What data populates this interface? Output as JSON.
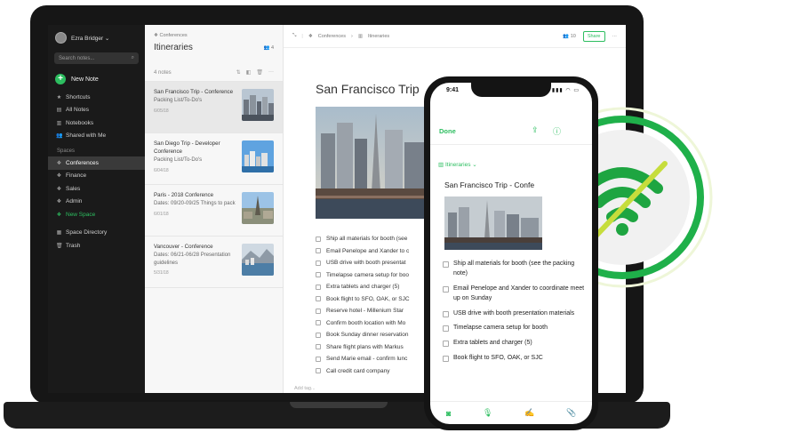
{
  "sidebar": {
    "user_name": "Ezra Bridger ⌄",
    "search_placeholder": "Search notes...",
    "new_note_label": "New Note",
    "items": [
      {
        "label": "Shortcuts",
        "icon": "star-icon"
      },
      {
        "label": "All Notes",
        "icon": "note-icon"
      },
      {
        "label": "Notebooks",
        "icon": "notebook-icon"
      },
      {
        "label": "Shared with Me",
        "icon": "people-icon"
      }
    ],
    "spaces_heading": "Spaces",
    "spaces": [
      {
        "label": "Conferences",
        "icon": "space-icon",
        "active": true
      },
      {
        "label": "Finance",
        "icon": "space-icon"
      },
      {
        "label": "Sales",
        "icon": "space-icon"
      },
      {
        "label": "Admin",
        "icon": "space-icon"
      },
      {
        "label": "New Space",
        "icon": "add-space-icon"
      }
    ],
    "footer_items": [
      {
        "label": "Space Directory",
        "icon": "directory-icon"
      },
      {
        "label": "Trash",
        "icon": "trash-icon"
      }
    ]
  },
  "notes_list": {
    "breadcrumb": "Conferences",
    "title": "Itineraries",
    "member_count": "4",
    "note_count": "4 notes",
    "notes": [
      {
        "title": "San Francisco Trip - Conference",
        "snippet": "Packing List/To-Do's",
        "date": "6/05/18"
      },
      {
        "title": "San Diego Trip - Developer Conference",
        "snippet": "Packing List/To-Do's",
        "date": "6/04/18"
      },
      {
        "title": "Paris - 2018 Conference",
        "snippet": "Dates: 09/20-09/25 Things to pack",
        "date": "6/01/18"
      },
      {
        "title": "Vancouver - Conference",
        "snippet": "Dates: 06/21-06/28 Presentation guidelines",
        "date": "5/31/18"
      }
    ]
  },
  "editor": {
    "breadcrumb_space": "Conferences",
    "breadcrumb_notebook": "Itineraries",
    "member_count": "10",
    "share_label": "Share",
    "title": "San Francisco Trip",
    "checklist": [
      "Ship all materials for booth (see",
      "Email Penelope and Xander to c",
      "USB drive with booth presentat",
      "Timelapse camera setup for boo",
      "Extra tablets and charger (5)",
      "Book flight to SFO, OAK, or SJC",
      "Reserve hotel - Millenium Star",
      "Confirm booth location with Mo",
      "Book Sunday dinner reservation",
      "Share flight plans with Markus",
      "Send Marie email - confirm lunc",
      "Call credit card company"
    ],
    "tags_placeholder": "Add tag..."
  },
  "phone": {
    "time": "9:41",
    "done_label": "Done",
    "notebook": "Itineraries ⌄",
    "title": "San Francisco Trip - Confe",
    "checklist": [
      "Ship all materials for booth (see the packing note)",
      "Email Penelope and Xander to coordinate meet up on Sunday",
      "USB drive with booth presentation materials",
      "Timelapse camera setup for booth",
      "Extra tablets and charger (5)",
      "Book flight to SFO, OAK, or SJC"
    ]
  },
  "colors": {
    "brand_green": "#2dbe60",
    "sidebar_bg": "#1a1a1a",
    "offline_slash": "#c6dd3c"
  }
}
